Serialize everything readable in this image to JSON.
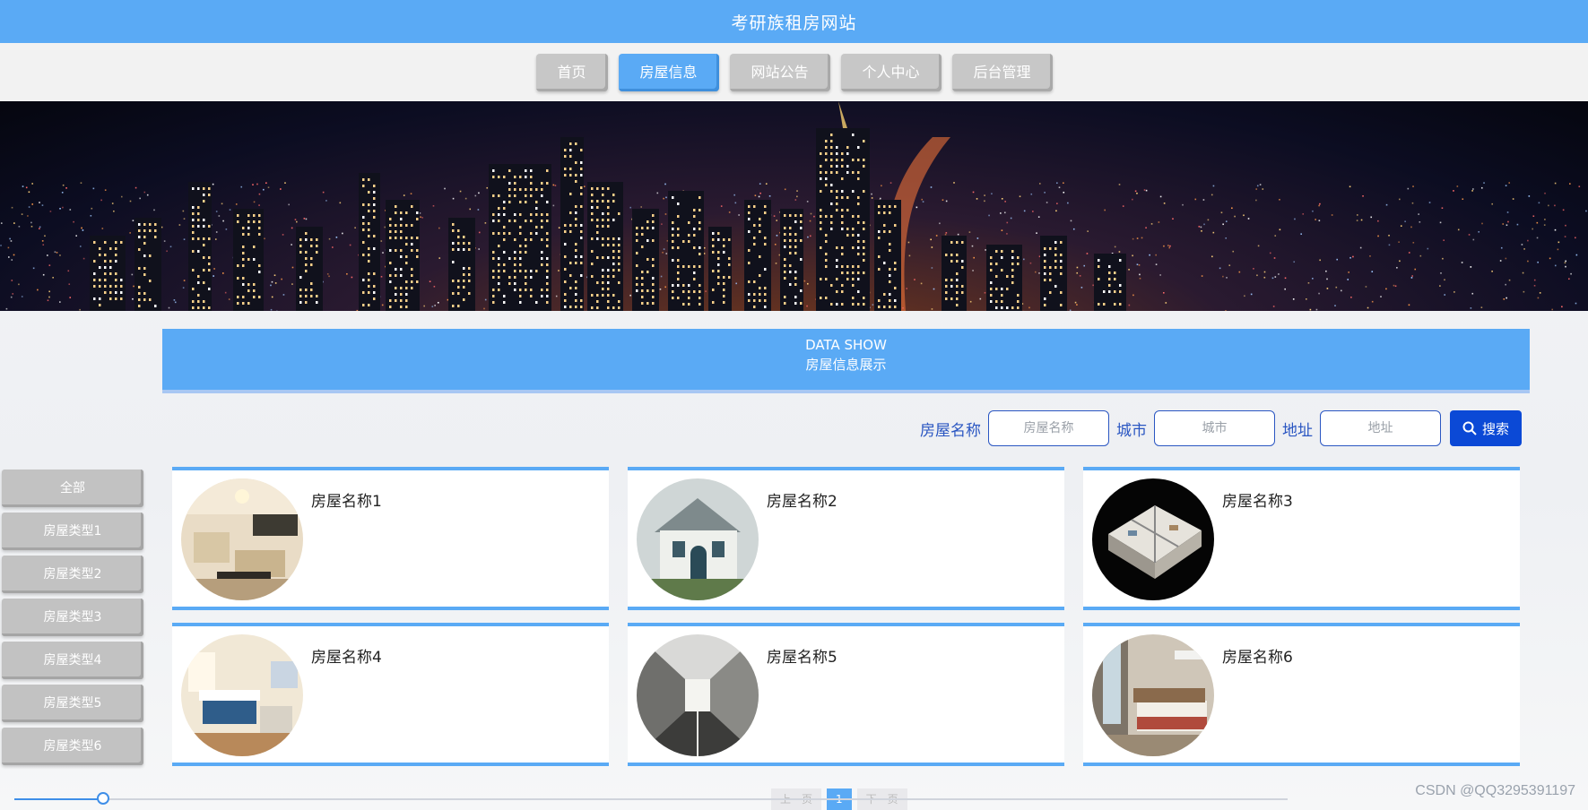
{
  "header": {
    "title": "考研族租房网站"
  },
  "nav": {
    "items": [
      {
        "label": "首页"
      },
      {
        "label": "房屋信息",
        "active": true
      },
      {
        "label": "网站公告"
      },
      {
        "label": "个人中心"
      },
      {
        "label": "后台管理"
      }
    ]
  },
  "banner": {
    "icon": "city-night-skyline"
  },
  "section": {
    "title_en": "DATA SHOW",
    "title_cn": "房屋信息展示"
  },
  "search": {
    "name_label": "房屋名称",
    "name_placeholder": "房屋名称",
    "city_label": "城市",
    "city_placeholder": "城市",
    "address_label": "地址",
    "address_placeholder": "地址",
    "button_label": "搜索",
    "button_icon": "search-icon"
  },
  "sidebar": {
    "items": [
      {
        "label": "全部"
      },
      {
        "label": "房屋类型1"
      },
      {
        "label": "房屋类型2"
      },
      {
        "label": "房屋类型3"
      },
      {
        "label": "房屋类型4"
      },
      {
        "label": "房屋类型5"
      },
      {
        "label": "房屋类型6"
      }
    ]
  },
  "listings": [
    {
      "name": "房屋名称1",
      "image": "living-room-photo"
    },
    {
      "name": "房屋名称2",
      "image": "villa-exterior-photo"
    },
    {
      "name": "房屋名称3",
      "image": "floorplan-3d-photo"
    },
    {
      "name": "房屋名称4",
      "image": "bedroom-photo"
    },
    {
      "name": "房屋名称5",
      "image": "corridor-photo"
    },
    {
      "name": "房屋名称6",
      "image": "modern-bedroom-photo"
    }
  ],
  "pagination": {
    "prev": "上一页",
    "current": "1",
    "next": "下一页"
  },
  "video_progress": {
    "fraction": 0.07
  },
  "watermark": "CSDN @QQ3295391197",
  "colors": {
    "primary": "#5aaaf5",
    "search_button": "#0b49d6",
    "label": "#2a56c2"
  }
}
